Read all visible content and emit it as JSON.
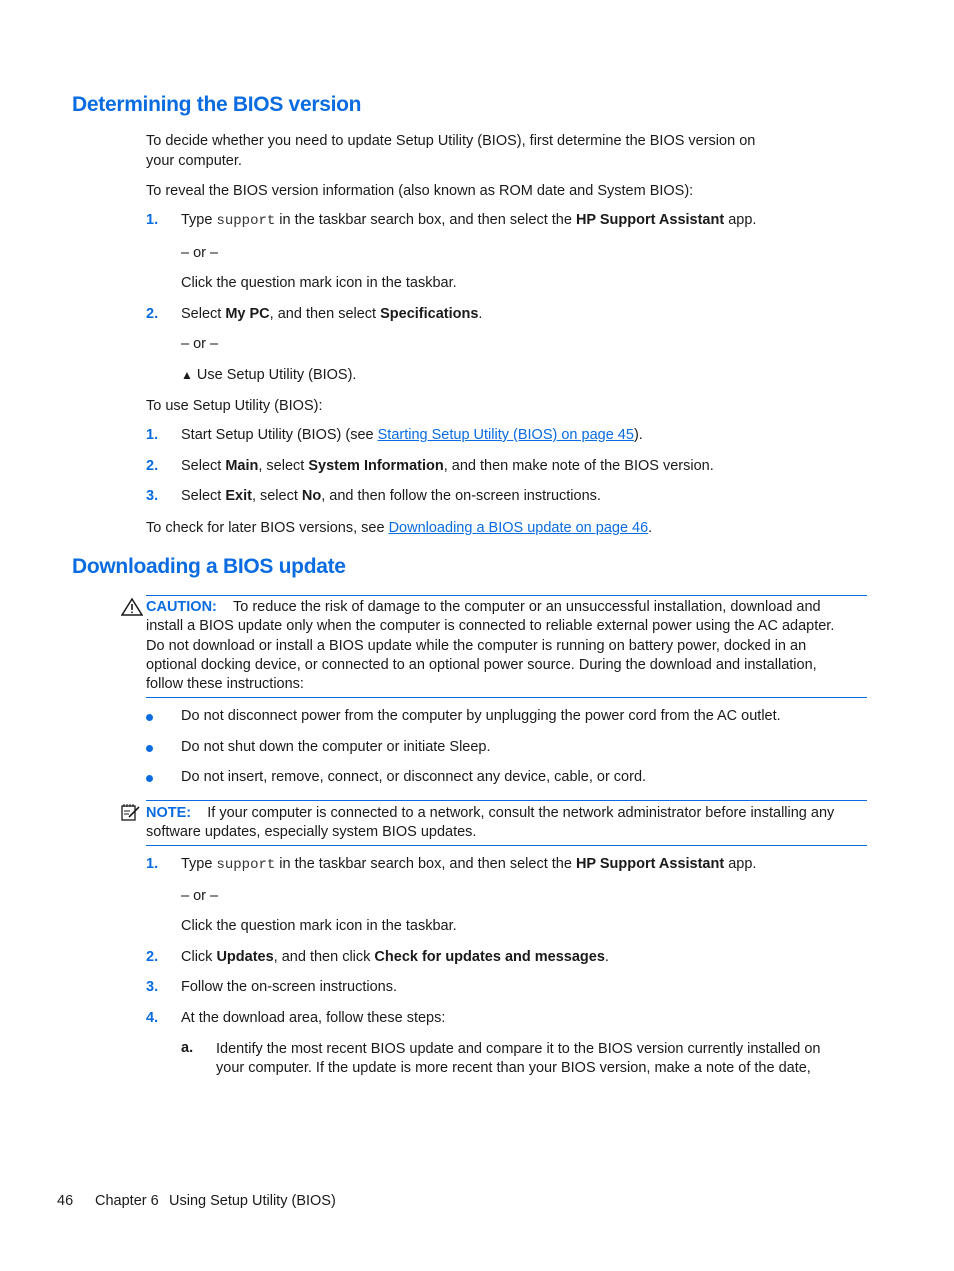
{
  "sections": [
    {
      "heading": "Determining the BIOS version",
      "intro": "To decide whether you need to update Setup Utility (BIOS), first determine the BIOS version on your computer.",
      "intro_line1": "To decide whether you need to update Setup Utility (BIOS), first determine the BIOS version on",
      "intro_line2": "your computer.",
      "reveal": "To reveal the BIOS version information (also known as ROM date and System BIOS):",
      "steps_a": [
        {
          "num": "1.",
          "pre": "Type ",
          "code": "support",
          "mid": " in the taskbar search box, and then select the ",
          "bold": "HP Support Assistant",
          "post": " app."
        },
        {
          "num": "2.",
          "pre": "Select ",
          "bold1": "My PC",
          "mid": ", and then select ",
          "bold2": "Specifications",
          "post": "."
        }
      ],
      "or_text": "– or –",
      "alt_click": "Click the question mark icon in the taskbar.",
      "alt_use": "Use Setup Utility (BIOS).",
      "use_intro": "To use Setup Utility (BIOS):",
      "steps_b": [
        {
          "num": "1.",
          "pre": "Start Setup Utility (BIOS) (see ",
          "link": "Starting Setup Utility (BIOS) on page 45",
          "post": ")."
        },
        {
          "num": "2.",
          "pre": "Select ",
          "bold1": "Main",
          "mid": ", select ",
          "bold2": "System Information",
          "post": ", and then make note of the BIOS version."
        },
        {
          "num": "3.",
          "pre": "Select ",
          "bold1": "Exit",
          "mid": ", select ",
          "bold2": "No",
          "post": ", and then follow the on-screen instructions."
        }
      ],
      "later_pre": "To check for later BIOS versions, see ",
      "later_link": "Downloading a BIOS update on page 46",
      "later_post": "."
    },
    {
      "heading": "Downloading a BIOS update",
      "caution": {
        "label": "CAUTION:",
        "lines": [
          "To reduce the risk of damage to the computer or an unsuccessful installation, download and",
          "install a BIOS update only when the computer is connected to reliable external power using the AC adapter.",
          "Do not download or install a BIOS update while the computer is running on battery power, docked in an",
          "optional docking device, or connected to an optional power source. During the download and installation,",
          "follow these instructions:"
        ]
      },
      "bullets": [
        "Do not disconnect power from the computer by unplugging the power cord from the AC outlet.",
        "Do not shut down the computer or initiate Sleep.",
        "Do not insert, remove, connect, or disconnect any device, cable, or cord."
      ],
      "note": {
        "label": "NOTE:",
        "lines": [
          "If your computer is connected to a network, consult the network administrator before installing any",
          "software updates, especially system BIOS updates."
        ]
      },
      "steps": [
        {
          "num": "1.",
          "pre": "Type ",
          "code": "support",
          "mid": " in the taskbar search box, and then select the ",
          "bold": "HP Support Assistant",
          "post": " app."
        },
        {
          "num": "2.",
          "pre": "Click ",
          "bold1": "Updates",
          "mid": ", and then click ",
          "bold2": "Check for updates and messages",
          "post": "."
        },
        {
          "num": "3.",
          "text": "Follow the on-screen instructions."
        },
        {
          "num": "4.",
          "text": "At the download area, follow these steps:"
        }
      ],
      "or_text": "– or –",
      "alt_click": "Click the question mark icon in the taskbar.",
      "substep": {
        "letter": "a.",
        "lines": [
          "Identify the most recent BIOS update and compare it to the BIOS version currently installed on",
          "your computer. If the update is more recent than your BIOS version, make a note of the date,"
        ]
      }
    }
  ],
  "footer": {
    "page_number": "46",
    "chapter": "Chapter 6",
    "chapter_title": "Using Setup Utility (BIOS)"
  },
  "colors": {
    "accent": "#0a6ce0",
    "text": "#1a1a1a"
  }
}
